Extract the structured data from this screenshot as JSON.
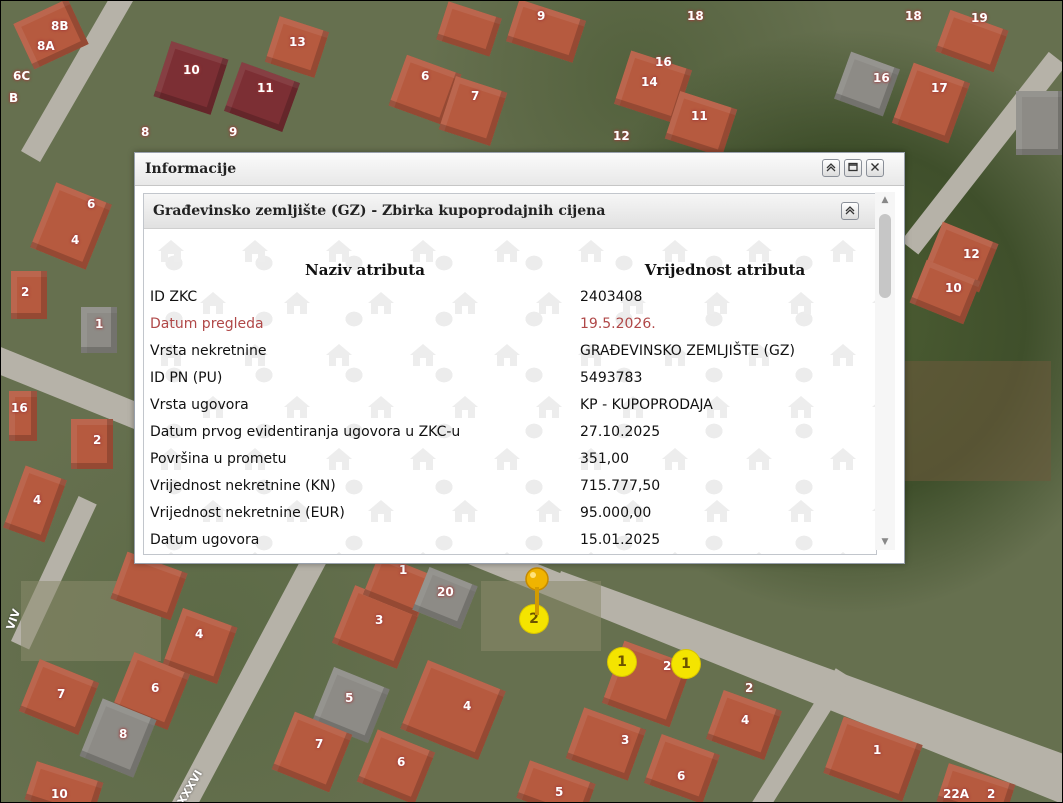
{
  "map": {
    "house_numbers": [
      "8B",
      "8A",
      "6C",
      "B",
      "10",
      "11",
      "13",
      "8",
      "9",
      "6",
      "7",
      "9",
      "18",
      "16",
      "14",
      "11",
      "12",
      "18",
      "19",
      "16",
      "17",
      "12",
      "10",
      "6",
      "4",
      "2",
      "1",
      "16",
      "2",
      "4",
      "20",
      "1",
      "3",
      "4",
      "6",
      "7",
      "8",
      "5",
      "4",
      "7",
      "6",
      "3",
      "2",
      "2",
      "4",
      "6",
      "5",
      "1",
      "22A",
      "2",
      "10"
    ],
    "street_labels": [
      "XXXVI",
      "VIV"
    ],
    "clusters": [
      {
        "count": "2"
      },
      {
        "count": "1"
      },
      {
        "count": "1"
      }
    ],
    "marker_icon": "map-pin-icon"
  },
  "info_window": {
    "title": "Informacije",
    "buttons": {
      "collapse": "«",
      "maximize": "□",
      "close": "✕"
    },
    "panel": {
      "title": "Građevinsko zemljište (GZ) - Zbirka kupoprodajnih cijena",
      "collapse_icon": "double-chevron-up-icon",
      "columns": [
        "Naziv atributa",
        "Vrijednost atributa"
      ],
      "rows": [
        {
          "name": "ID ZKC",
          "value": "2403408",
          "highlight": false
        },
        {
          "name": "Datum pregleda",
          "value": "19.5.2026.",
          "highlight": true
        },
        {
          "name": "Vrsta nekretnine",
          "value": "GRAĐEVINSKO ZEMLJIŠTE (GZ)",
          "highlight": false
        },
        {
          "name": "ID PN (PU)",
          "value": "5493783",
          "highlight": false
        },
        {
          "name": "Vrsta ugovora",
          "value": "KP - KUPOPRODAJA",
          "highlight": false
        },
        {
          "name": "Datum prvog evidentiranja ugovora u ZKC-u",
          "value": "27.10.2025",
          "highlight": false
        },
        {
          "name": "Površina u prometu",
          "value": "351,00",
          "highlight": false
        },
        {
          "name": "Vrijednost nekretnine (KN)",
          "value": "715.777,50",
          "highlight": false
        },
        {
          "name": "Vrijednost nekretnine (EUR)",
          "value": "95.000,00",
          "highlight": false
        },
        {
          "name": "Datum ugovora",
          "value": "15.01.2025",
          "highlight": false
        }
      ]
    },
    "colors": {
      "highlight_text": "#b04848",
      "cluster_fill": "#f4e400",
      "pin": "#f0b400"
    }
  }
}
